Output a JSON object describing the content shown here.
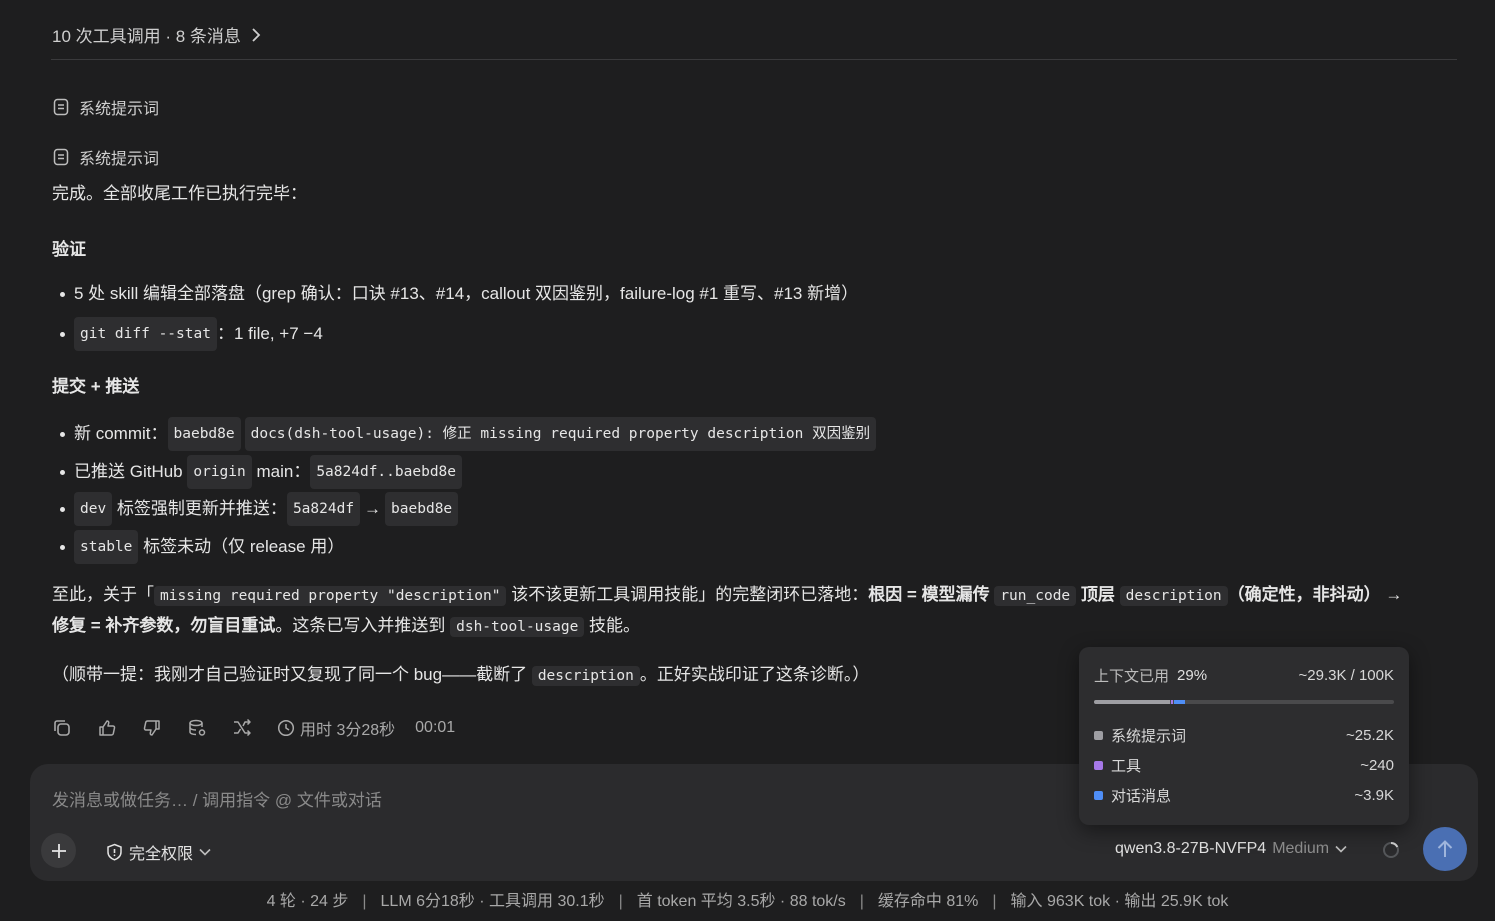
{
  "colors": {
    "background": "#1e1e1f",
    "composer": "#2b2b2d",
    "send_button": "#4a6fb3",
    "system_prompt": "#9e9ea3",
    "tools": "#a678e8",
    "conversation": "#4f8ef7"
  },
  "header": {
    "summary": "10 次工具调用 · 8 条消息",
    "chevron_icon": "chevron-right-icon"
  },
  "system_prompts": [
    {
      "label": "系统提示词",
      "icon": "document-icon"
    },
    {
      "label": "系统提示词",
      "icon": "document-icon"
    }
  ],
  "message": {
    "intro": "完成。全部收尾工作已执行完毕：",
    "section1": {
      "heading": "验证",
      "items": [
        {
          "text": "5 处 skill 编辑全部落盘（grep 确认：口诀 #13、#14，callout 双因鉴别，failure-log #1 重写、#13 新增）"
        },
        {
          "code": "git diff --stat",
          "text": "：1 file, +7 −4"
        }
      ]
    },
    "section2": {
      "heading": "提交 + 推送",
      "item1": {
        "prefix": "新 commit：",
        "hash": "baebd8e",
        "msg": "docs(dsh-tool-usage): 修正 missing required property description 双因鉴别"
      },
      "item2": {
        "prefix": "已推送 GitHub ",
        "remote": "origin",
        "mid": " main：",
        "range": "5a824df..baebd8e"
      },
      "item3": {
        "tag": "dev",
        "mid": " 标签强制更新并推送：",
        "from": "5a824df",
        "arrow": "→",
        "to": "baebd8e"
      },
      "item4": {
        "tag": "stable",
        "text": " 标签未动（仅 release 用）"
      }
    },
    "conclusion": {
      "p1": "至此，关于「",
      "c1": "missing required property \"description\"",
      "p2": " 该不该更新工具调用技能」的完整闭环已落地：",
      "b1": "根因 = 模型漏传 ",
      "c2": "run_code",
      "b2": " 顶层 ",
      "c3": "description",
      "b3": "（确定性，非抖动）",
      "arrow": " →",
      "b4": "修复 = 补齐参数，勿盲目重试",
      "p3": "。这条已写入并推送到 ",
      "c4": "dsh-tool-usage",
      "p4": " 技能。"
    },
    "aside": {
      "p1": "（顺带一提：我刚才自己验证时又复现了同一个 bug——截断了 ",
      "c1": "description",
      "p2": "。正好实战印证了这条诊断。）"
    }
  },
  "actions": {
    "icons": [
      "copy-icon",
      "thumbs-up-icon",
      "thumbs-down-icon",
      "database-settings-icon",
      "branch-icon"
    ],
    "duration": "用时 3分28秒",
    "timer": "00:01"
  },
  "context_popover": {
    "title": "上下文已用",
    "percent": "29%",
    "usage": "~29.3K / 100K",
    "used_fraction": 0.293,
    "segments": [
      {
        "label": "系统提示词",
        "value": "~25.2K",
        "fraction": 0.252,
        "color": "#9e9ea3"
      },
      {
        "label": "工具",
        "value": "~240",
        "fraction": 0.0024,
        "color": "#a678e8"
      },
      {
        "label": "对话消息",
        "value": "~3.9K",
        "fraction": 0.039,
        "color": "#4f8ef7"
      }
    ]
  },
  "composer": {
    "placeholder": "发消息或做任务… / 调用指令 @ 文件或对话",
    "permission": "完全权限",
    "model": "qwen3.8-27B-NVFP4",
    "effort": "Medium"
  },
  "stats_bar": {
    "items": [
      "4 轮 · 24 步",
      "LLM 6分18秒 · 工具调用 30.1秒",
      "首 token 平均 3.5秒 · 88 tok/s",
      "缓存命中 81%",
      "输入 963K tok · 输出 25.9K tok"
    ],
    "separator": "|"
  }
}
